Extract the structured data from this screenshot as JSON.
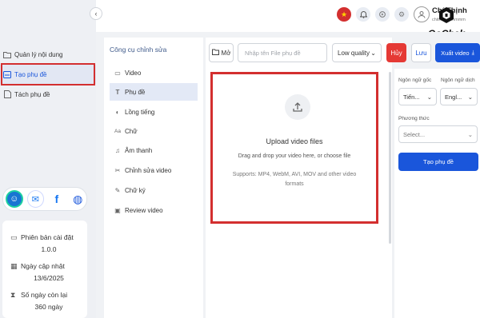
{
  "sidebar": {
    "items": [
      {
        "label": "Quản lý nội dung",
        "icon": "folder-icon"
      },
      {
        "label": "Tạo phụ đề",
        "icon": "subtitle-icon"
      },
      {
        "label": "Tách phụ đề",
        "icon": "document-icon"
      }
    ],
    "social": [
      "assistant-icon",
      "messenger-icon",
      "facebook-icon",
      "globe-icon"
    ],
    "info": {
      "version_label": "Phiên bản cài đặt",
      "version_value": "1.0.0",
      "updated_label": "Ngày cập nhật",
      "updated_value": "13/6/2025",
      "days_label": "Số ngày còn lại",
      "days_value": "360 ngày"
    }
  },
  "header": {
    "user_name": "Chí Thịnh",
    "user_email": "chithinhmmmmm",
    "logo_text": "GoChek"
  },
  "tools": {
    "title": "Công cụ chỉnh sửa",
    "items": [
      {
        "label": "Video",
        "icon": "video-icon"
      },
      {
        "label": "Phụ đề",
        "icon": "text-icon"
      },
      {
        "label": "Lồng tiếng",
        "icon": "voice-icon"
      },
      {
        "label": "Chữ",
        "icon": "font-icon"
      },
      {
        "label": "Âm thanh",
        "icon": "music-icon"
      },
      {
        "label": "Chỉnh sửa video",
        "icon": "edit-video-icon"
      },
      {
        "label": "Chữ ký",
        "icon": "signature-icon"
      },
      {
        "label": "Review video",
        "icon": "review-icon"
      }
    ]
  },
  "toolbar": {
    "open_label": "Mở",
    "file_placeholder": "Nhập tên File phụ đề",
    "quality_value": "Low quality",
    "cancel_label": "Hủy",
    "save_label": "Lưu",
    "export_label": "Xuất video"
  },
  "upload": {
    "title": "Upload video files",
    "subtitle": "Drag and drop your video here, or choose file",
    "formats": "Supports: MP4, WebM, AVI, MOV and other video formats"
  },
  "settings": {
    "source_lang_label": "Ngôn ngữ gốc",
    "source_lang_value": "Tiến...",
    "target_lang_label": "Ngôn ngữ dịch",
    "target_lang_value": "Engl...",
    "method_label": "Phương thức",
    "method_placeholder": "Select...",
    "create_label": "Tạo phụ đề"
  },
  "colors": {
    "accent": "#1a56db",
    "danger": "#e53935",
    "highlight_box": "#d32f2f"
  }
}
